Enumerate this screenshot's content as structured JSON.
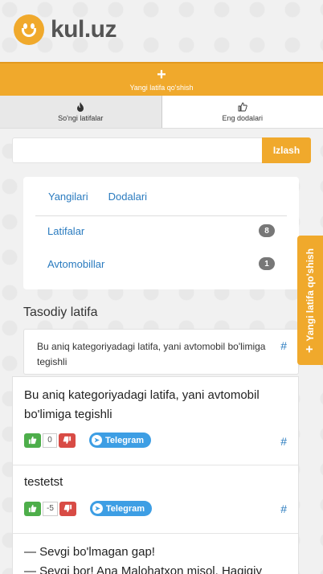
{
  "brand": {
    "name": "kul.uz"
  },
  "add_button": {
    "label": "Yangi latifa qo'shish"
  },
  "tabs": [
    {
      "label": "So'ngi latifalar",
      "icon": "fire-icon"
    },
    {
      "label": "Eng dodalari",
      "icon": "thumbs-up-icon"
    }
  ],
  "search": {
    "value": "",
    "placeholder": "",
    "button_label": "Izlash"
  },
  "categories": {
    "header_tabs": [
      "Yangilari",
      "Dodalari"
    ],
    "items": [
      {
        "label": "Latifalar",
        "count": "8"
      },
      {
        "label": "Avtomobillar",
        "count": "1"
      }
    ]
  },
  "random": {
    "title": "Tasodiy latifa",
    "text": "Bu aniq kategoriyadagi latifa, yani avtomobil bo'limiga tegishli",
    "hash": "#"
  },
  "jokes": [
    {
      "text": "Bu aniq kategoriyadagi latifa, yani avtomobil bo'limiga tegishli",
      "votes": "0",
      "share": "Telegram",
      "hash": "#"
    },
    {
      "text": "testetst",
      "votes": "-5",
      "share": "Telegram",
      "hash": "#"
    },
    {
      "text": "— Sevgi bo'lmagan gap!\n— Sevgi bor! Ana Malohatxon misol. Haqiqiy"
    }
  ],
  "side_tab": {
    "label": "Yangi latifa qo'shish"
  },
  "colors": {
    "accent": "#f0a92c",
    "link": "#2a7bbf",
    "up": "#4dae4a",
    "down": "#d84b45",
    "telegram": "#3d9ee4"
  }
}
